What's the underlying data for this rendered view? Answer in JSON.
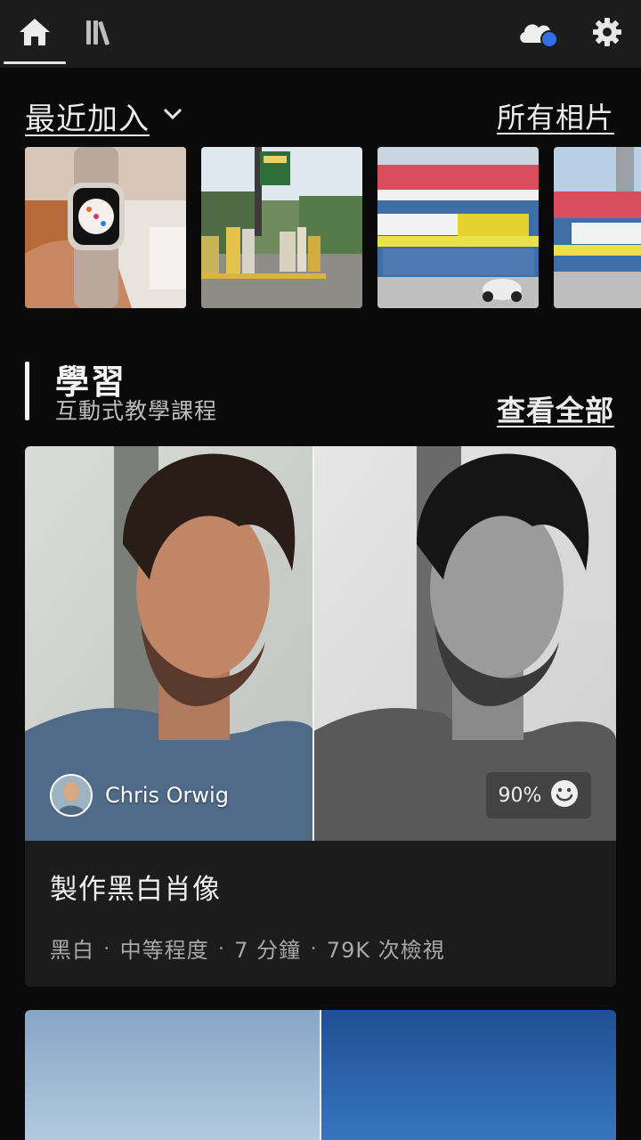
{
  "topbar": {
    "tabs": [
      {
        "name": "home",
        "icon": "home-icon",
        "selected": true
      },
      {
        "name": "library",
        "icon": "library-icon",
        "selected": false
      }
    ],
    "cloud_status_color": "#2f6fe4",
    "icons": [
      "cloud-icon",
      "gear-icon"
    ]
  },
  "recent": {
    "title": "最近加入",
    "all_photos_label": "所有相片"
  },
  "learn": {
    "title": "學習",
    "subtitle": "互動式教學課程",
    "view_all_label": "查看全部"
  },
  "tutorial_card": {
    "author": "Chris Orwig",
    "rating": "90%",
    "title": "製作黑白肖像",
    "meta": {
      "category": "黑白",
      "level": "中等程度",
      "duration": "7 分鐘",
      "views": "79K 次檢視"
    },
    "separator": "·"
  },
  "colors": {
    "background": "#0a0a0a",
    "topbar": "#1c1c1c",
    "card": "#1c1c1c",
    "accent_blue": "#2f6fe4"
  }
}
